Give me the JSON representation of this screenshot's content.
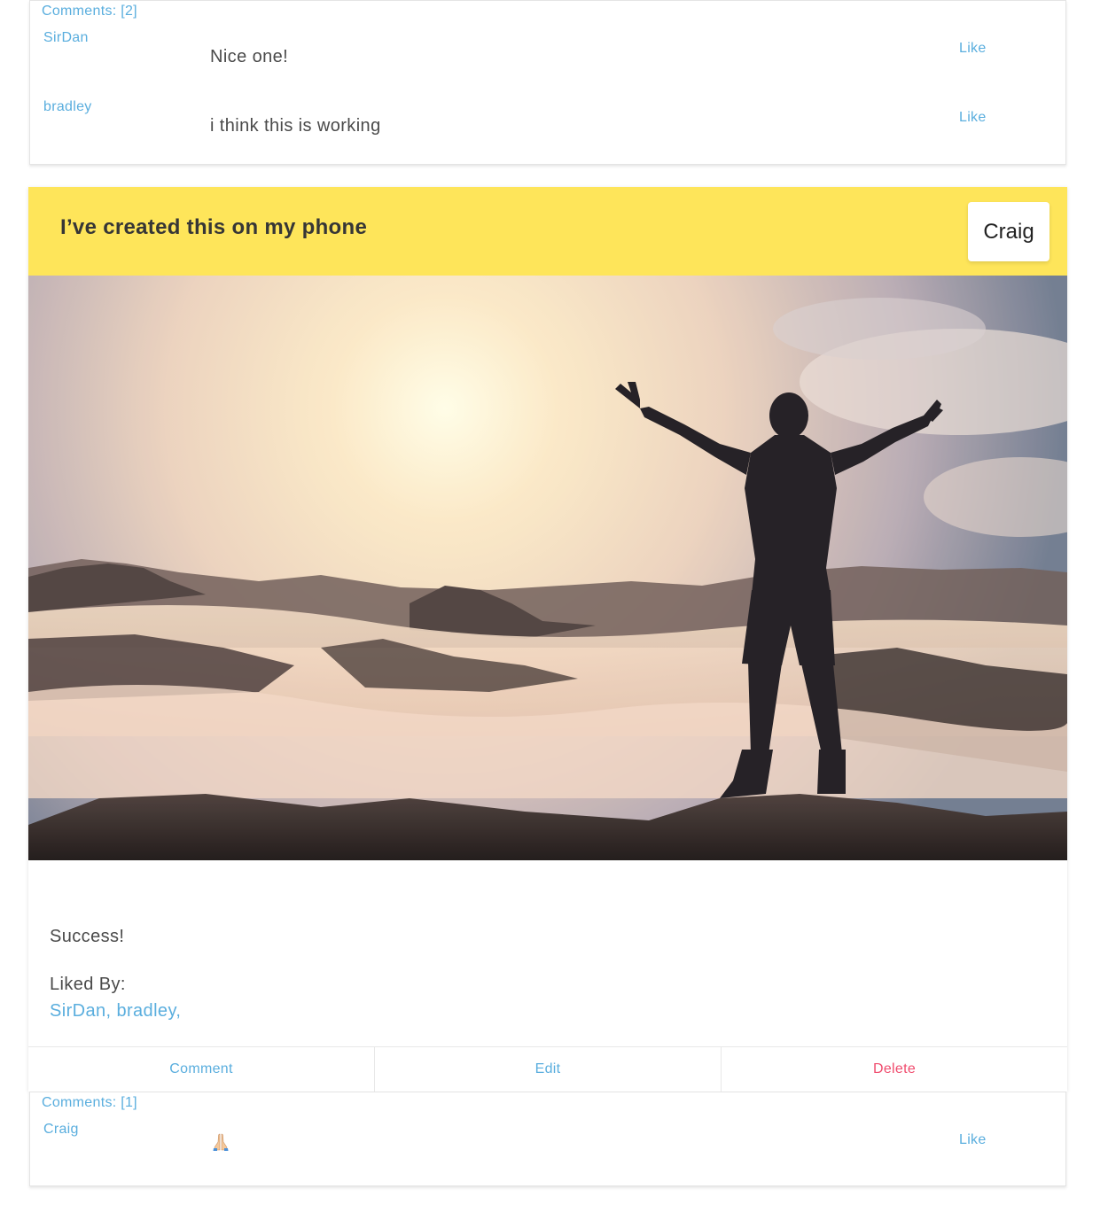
{
  "top_comments": {
    "count_label": "Comments: [2]",
    "items": [
      {
        "author": "SirDan",
        "text": "Nice one!",
        "like_label": "Like"
      },
      {
        "author": "bradley",
        "text": "i think this is working",
        "like_label": "Like"
      }
    ]
  },
  "post": {
    "title": "I’ve created this on my phone",
    "author": "Craig",
    "header_color": "#fee55a",
    "image_icon": "photo-man-arms-raised-mountain-sunrise",
    "body": "Success!",
    "liked_by_label": "Liked By:",
    "liked_by_users": "SirDan, bradley,",
    "footer": {
      "comment_label": "Comment",
      "edit_label": "Edit",
      "delete_label": "Delete"
    }
  },
  "bottom_comments": {
    "count_label": "Comments: [1]",
    "items": [
      {
        "author": "Craig",
        "icon": "folded-hands-emoji",
        "like_label": "Like"
      }
    ]
  },
  "colors": {
    "link": "#5aaede",
    "danger": "#f04c6e",
    "text": "#4a4a4a"
  }
}
